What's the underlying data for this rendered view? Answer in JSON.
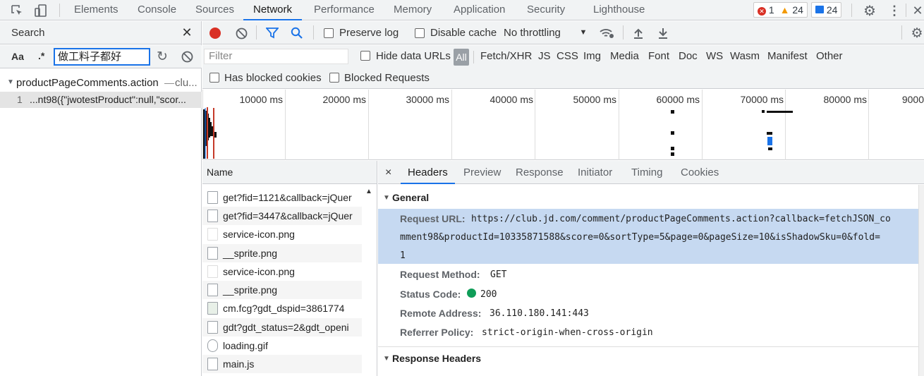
{
  "devtools": {
    "tabs": [
      "Elements",
      "Console",
      "Sources",
      "Network",
      "Performance",
      "Memory",
      "Application",
      "Security",
      "Lighthouse"
    ],
    "active_tab": "Network",
    "badges": {
      "errors": "1",
      "warnings": "24",
      "messages": "24"
    }
  },
  "search": {
    "title": "Search",
    "case_label": "Aa",
    "regex_label": ".*",
    "query": "做工料子都好",
    "result_file": "productPageComments.action",
    "result_file_suffix": "clu...",
    "result_line_no": "1",
    "result_line_text": "...nt98({\"jwotestProduct\":null,\"scor..."
  },
  "network_toolbar": {
    "preserve_log": "Preserve log",
    "disable_cache": "Disable cache",
    "throttling": "No throttling"
  },
  "filter": {
    "placeholder": "Filter",
    "hide_data_urls": "Hide data URLs",
    "types": [
      "All",
      "Fetch/XHR",
      "JS",
      "CSS",
      "Img",
      "Media",
      "Font",
      "Doc",
      "WS",
      "Wasm",
      "Manifest",
      "Other"
    ],
    "has_blocked_cookies": "Has blocked cookies",
    "blocked_requests": "Blocked Requests"
  },
  "timeline": {
    "ticks": [
      "10000 ms",
      "20000 ms",
      "30000 ms",
      "40000 ms",
      "50000 ms",
      "60000 ms",
      "70000 ms",
      "80000 ms",
      "9000"
    ]
  },
  "request_list": {
    "header": "Name",
    "rows": [
      "get?fid=1121&callback=jQuer",
      "get?fid=3447&callback=jQuer",
      "service-icon.png",
      "__sprite.png",
      "service-icon.png",
      "__sprite.png",
      "cm.fcg?gdt_dspid=3861774",
      "gdt?gdt_status=2&gdt_openi",
      "loading.gif",
      "main.js"
    ]
  },
  "details": {
    "close": "×",
    "tabs": [
      "Headers",
      "Preview",
      "Response",
      "Initiator",
      "Timing",
      "Cookies"
    ],
    "active_tab": "Headers",
    "general_title": "General",
    "request_url_label": "Request URL:",
    "request_url_line1": "https://club.jd.com/comment/productPageComments.action?callback=fetchJSON_co",
    "request_url_line2": "mment98&productId=10335871588&score=0&sortType=5&page=0&pageSize=10&isShadowSku=0&fold=",
    "request_url_line3": "1",
    "request_method_label": "Request Method:",
    "request_method": "GET",
    "status_code_label": "Status Code:",
    "status_code": "200",
    "remote_address_label": "Remote Address:",
    "remote_address": "36.110.180.141:443",
    "referrer_policy_label": "Referrer Policy:",
    "referrer_policy": "strict-origin-when-cross-origin",
    "response_headers_title": "Response Headers"
  },
  "colors": {
    "accent": "#1a73e8",
    "record": "#d93025",
    "status_ok": "#0f9d58",
    "highlight": "#c6d9f1"
  }
}
